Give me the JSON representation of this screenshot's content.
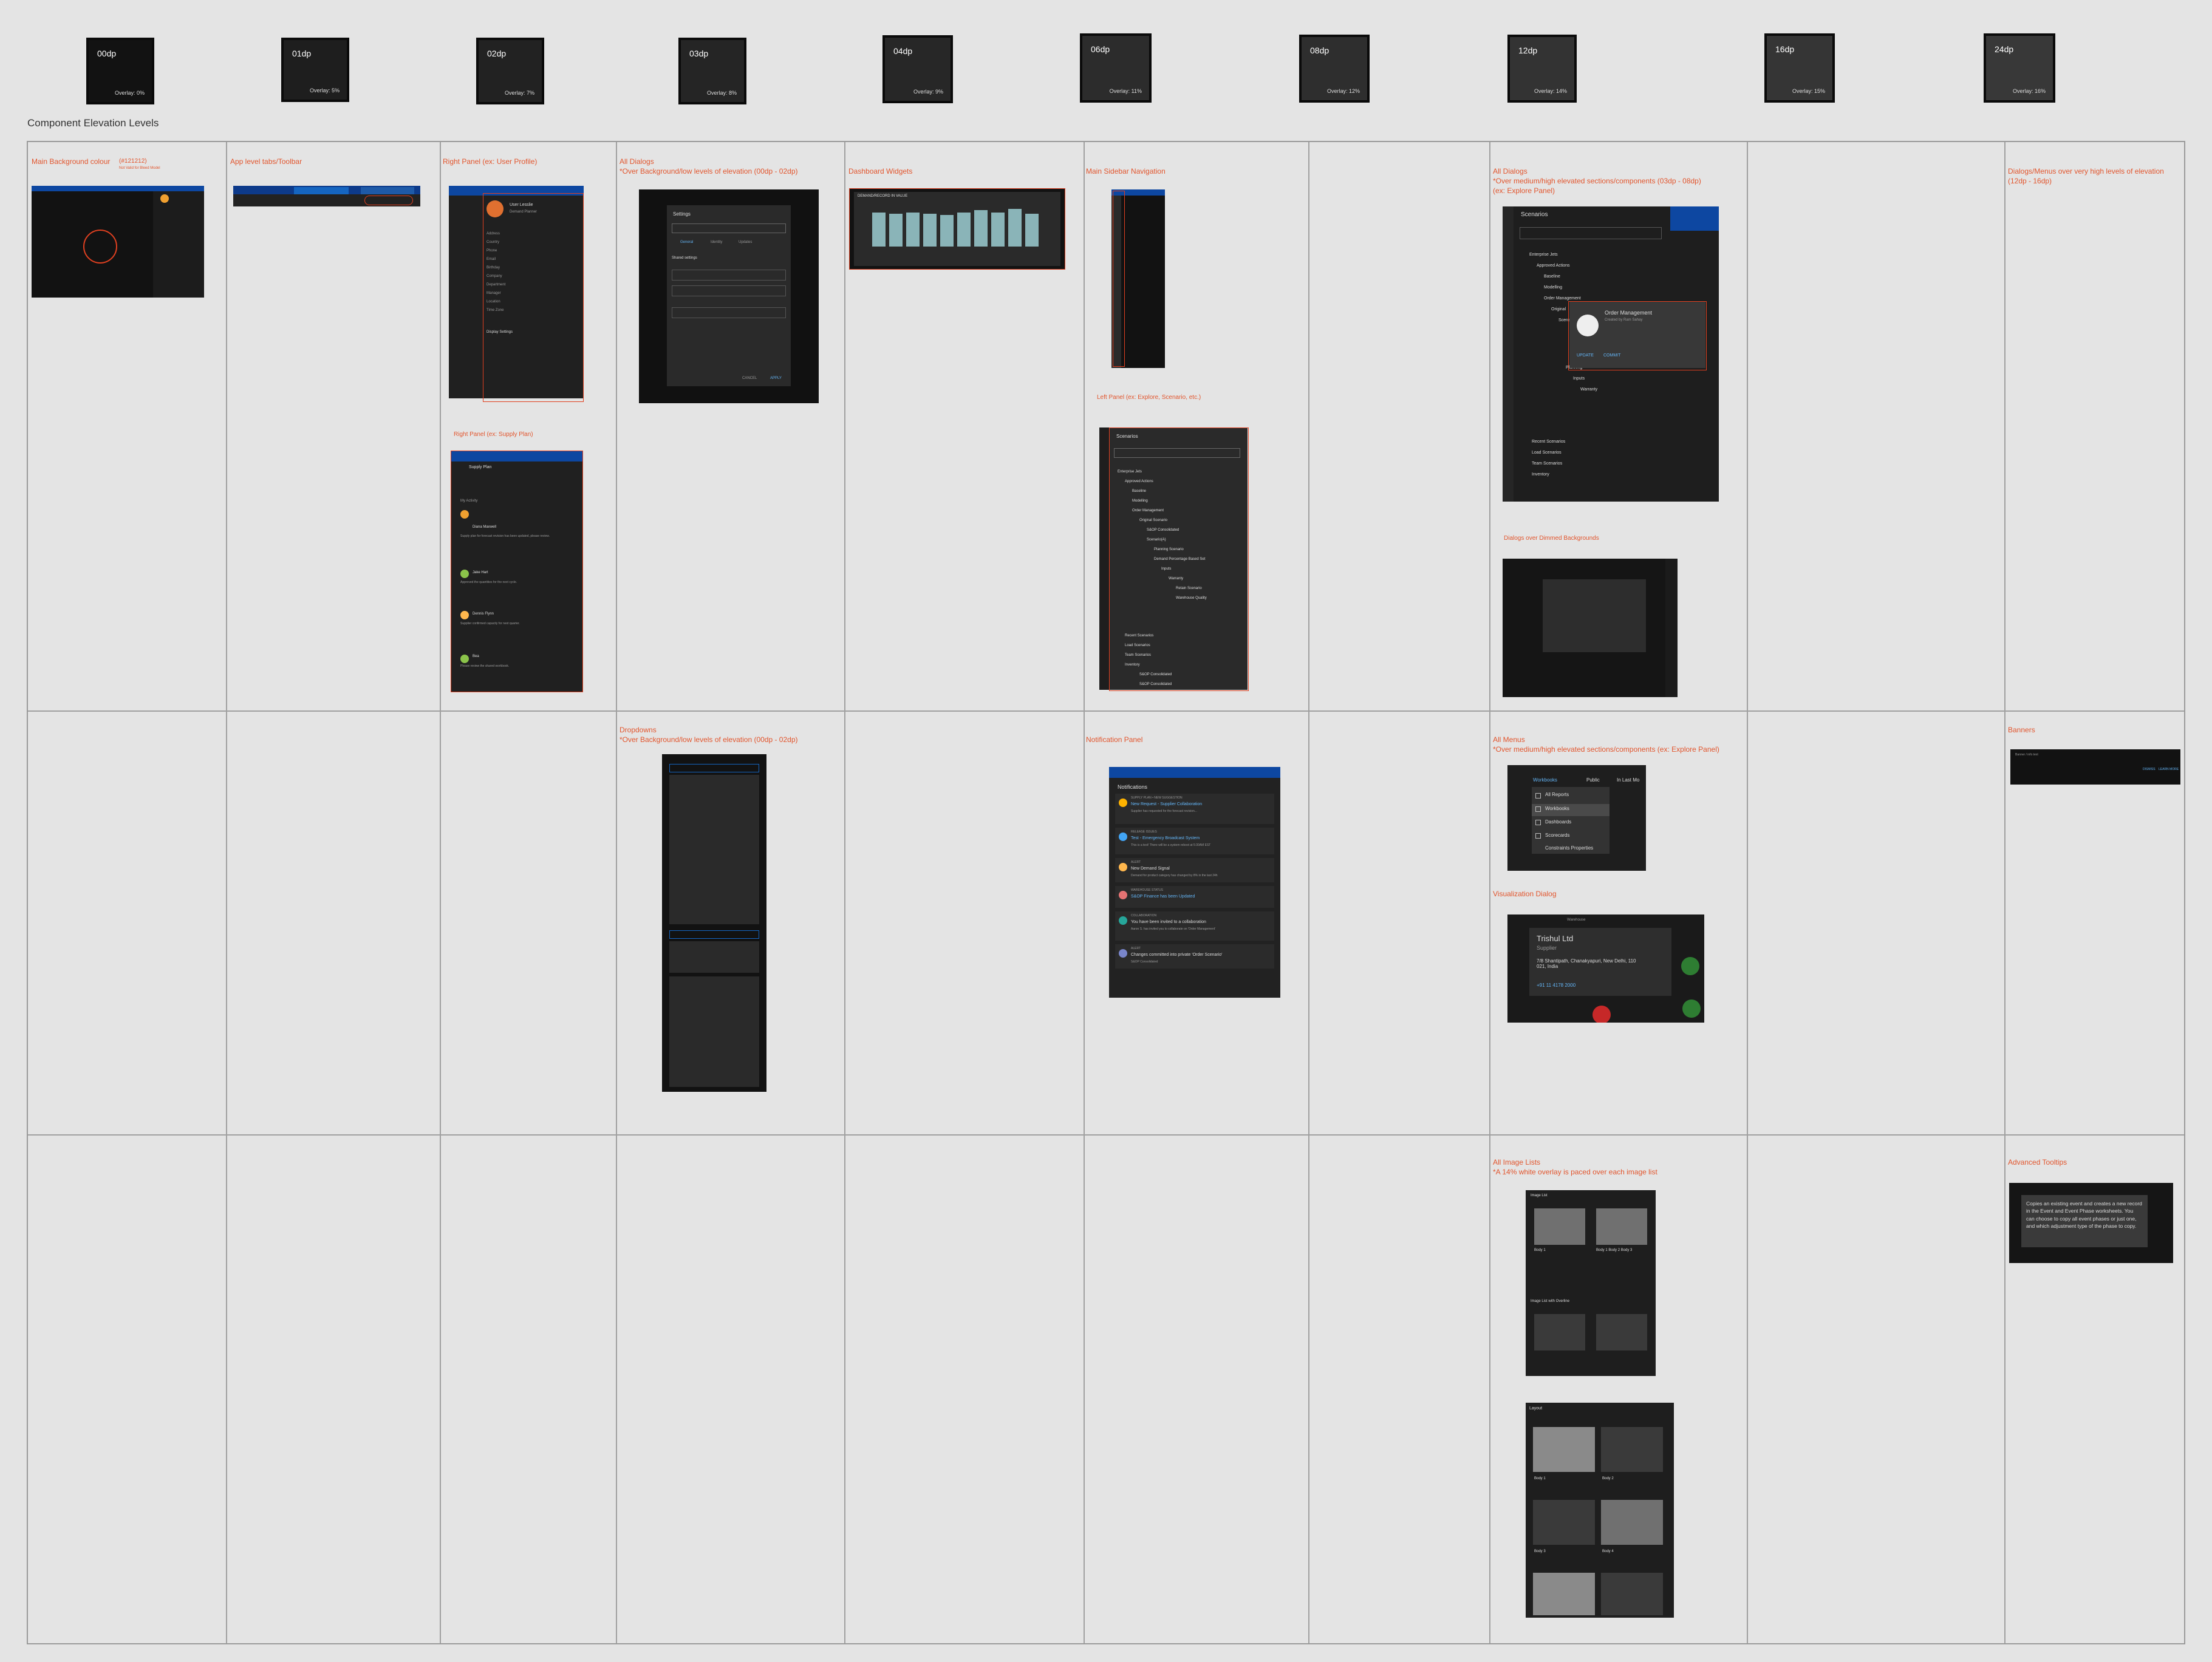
{
  "elevation_levels": [
    {
      "dp": "00dp",
      "overlay": "Overlay: 0%",
      "color": "#121212"
    },
    {
      "dp": "01dp",
      "overlay": "Overlay: 5%",
      "color": "#1e1e1e"
    },
    {
      "dp": "02dp",
      "overlay": "Overlay: 7%",
      "color": "#222222"
    },
    {
      "dp": "03dp",
      "overlay": "Overlay: 8%",
      "color": "#252525"
    },
    {
      "dp": "04dp",
      "overlay": "Overlay: 9%",
      "color": "#272727"
    },
    {
      "dp": "06dp",
      "overlay": "Overlay: 11%",
      "color": "#2c2c2c"
    },
    {
      "dp": "08dp",
      "overlay": "Overlay: 12%",
      "color": "#2e2e2e"
    },
    {
      "dp": "12dp",
      "overlay": "Overlay: 14%",
      "color": "#333333"
    },
    {
      "dp": "16dp",
      "overlay": "Overlay: 15%",
      "color": "#353535"
    },
    {
      "dp": "24dp",
      "overlay": "Overlay: 16%",
      "color": "#383838"
    }
  ],
  "section_title": "Component Elevation Levels",
  "labels": {
    "main_bg": "Main Background colour",
    "main_bg_hex": "(#121212)",
    "main_bg_note": "Not Valid for Bleed Model",
    "app_tabs": "App level tabs/Toolbar",
    "right_panel_user": "Right Panel (ex: User Profile)",
    "right_panel_supply": "Right Panel (ex: Supply Plan)",
    "all_dialogs_low_1": "All Dialogs",
    "all_dialogs_low_2": "*Over Background/low levels of elevation (00dp - 02dp)",
    "dashboard_widgets": "Dashboard Widgets",
    "main_sidebar": "Main Sidebar Navigation",
    "left_panel": "Left Panel (ex: Explore, Scenario, etc.)",
    "all_dialogs_med_1": "All Dialogs",
    "all_dialogs_med_2": "*Over medium/high elevated sections/components (03dp - 08dp)",
    "all_dialogs_med_3": "(ex: Explore Panel)",
    "dialogs_dimmed": "Dialogs over Dimmed Backgrounds",
    "dialogs_high_1": "Dialogs/Menus over very high levels of elevation",
    "dialogs_high_2": "(12dp - 16dp)",
    "dropdowns_1": "Dropdowns",
    "dropdowns_2": "*Over Background/low levels of elevation (00dp - 02dp)",
    "notification_panel": "Notification Panel",
    "all_menus_1": "All Menus",
    "all_menus_2": "*Over medium/high elevated sections/components (ex: Explore Panel)",
    "visualization_dialog": "Visualization Dialog",
    "banners": "Banners",
    "image_lists_1": "All Image Lists",
    "image_lists_2": "*A 14% white overlay is paced over each image list",
    "advanced_tooltips": "Advanced Tooltips"
  },
  "settings_dialog": {
    "title": "Settings",
    "tabs": [
      "General",
      "Identity",
      "Updates"
    ],
    "section": "Shared settings",
    "cancel": "CANCEL",
    "apply": "APPLY"
  },
  "dashboard_widget": {
    "title": "DEMAND/RECORD IN VALUE"
  },
  "scenarios_panel": {
    "title": "Scenarios",
    "items": [
      "Enterprise Jets",
      "Approved Actions",
      "Baseline",
      "Modelling",
      "Order Management",
      "Original Scenario",
      "S&OP Consolidated",
      "Scenario(A)",
      "Planning Scenario",
      "Demand Percentage Based Set",
      "Inputs",
      "Warranty",
      "Retain Scenario",
      "Warehouse Quality",
      "Recent Scenarios",
      "Load Scenarios",
      "Team Scenarios",
      "Inventory",
      "S&OP Consolidated",
      "S&OP Consolidated"
    ]
  },
  "explore_panel": {
    "title": "Scenarios",
    "items": [
      "Enterprise Jets",
      "Approved Actions",
      "Baseline",
      "Modelling",
      "Order Management",
      "Original",
      "Scenario(A)",
      "Planning",
      "Inputs",
      "Warranty",
      "Recent Scenarios",
      "Load Scenarios",
      "Team Scenarios",
      "Inventory"
    ],
    "popup_title": "Order Management",
    "popup_sub": "Created by Ram Sahay",
    "popup_update": "UPDATE",
    "popup_commit": "COMMIT"
  },
  "notifications": {
    "title": "Notifications",
    "items": [
      {
        "meta": "SUPPLY PLAN • NEW SUGGESTION",
        "title": "New Request - Supplier Collaboration",
        "body": "Supplier has requested for the forecast revision..."
      },
      {
        "meta": "RELEASE ISSUES",
        "title": "Test - Emergency Broadcast System",
        "body": "This is a test! There will be a system reboot at 5:30AM EST"
      },
      {
        "meta": "ALERT",
        "title": "New Demand Signal",
        "body": "Demand for product category has changed by 8% in the last 24h"
      },
      {
        "meta": "WAREHOUSE STATUS",
        "title": "S&OP Finance has been Updated",
        "body": ""
      },
      {
        "meta": "COLLABORATION",
        "title": "You have been invited to a collaboration",
        "body": "Aaron S. has invited you to collaborate on 'Order Management'"
      },
      {
        "meta": "ALERT",
        "title": "Changes committed into private 'Order Scenario'",
        "body": "S&OP Consolidated"
      }
    ]
  },
  "menu": {
    "tabs": [
      "Workbooks",
      "Public",
      "In Last Mo"
    ],
    "items": [
      "All Reports",
      "Workbooks",
      "Dashboards",
      "Scorecards",
      "Constraints Properties"
    ]
  },
  "visualization": {
    "header": "Warehouse",
    "company": "Trishul Ltd",
    "type": "Supplier",
    "address": "7/8 Shantipath, Chanakyapuri, New Delhi, 110 021, India",
    "phone": "+91 11 4178 2000"
  },
  "banner": {
    "text": "Banner / info text",
    "action1": "DISMISS",
    "action2": "LEARN MORE"
  },
  "tooltip": {
    "text": "Copies an existing event and creates a new record in the Event and Event Phase worksheets. You can choose to copy all event phases or just one, and which adjustment type of the phase to copy."
  },
  "image_list_a": {
    "header": "Image List",
    "body1": "Body 1",
    "body2": "Body 1 Body 2 Body 3",
    "header2": "Image List with Overline"
  },
  "layout_list": {
    "header": "Layout",
    "cells": [
      "Body 1",
      "Body 2",
      "Body 3",
      "Body 4"
    ]
  },
  "user_profile": {
    "name": "User Lesslie",
    "role": "Demand Planner",
    "fields": [
      "Address",
      "Country",
      "Phone",
      "Email",
      "Birthday",
      "Company",
      "Department",
      "Manager",
      "Location",
      "Time Zone"
    ],
    "settings": "Display Settings"
  },
  "supply_plan": {
    "title": "Supply Plan",
    "subtitle": "My Activity",
    "comments": [
      {
        "name": "Diana Maxwell",
        "text": "Supply plan for forecast revision has been updated, please review."
      },
      {
        "name": "Jake Hart",
        "text": "Approved the quantities for the next cycle."
      },
      {
        "name": "Dennis Flynn",
        "text": "Supplier confirmed capacity for next quarter."
      },
      {
        "name": "Bea",
        "text": "Please review the shared workbook."
      }
    ]
  }
}
